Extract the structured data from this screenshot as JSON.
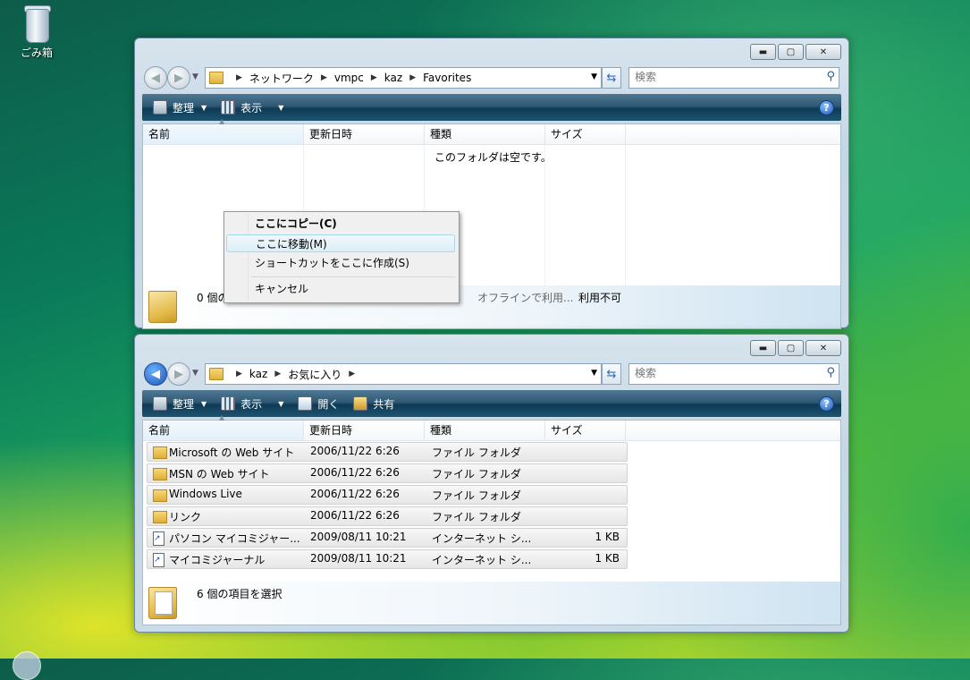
{
  "desktop": {
    "recycle_bin": "ごみ箱"
  },
  "window1": {
    "breadcrumbs": [
      "ネットワーク",
      "vmpc",
      "kaz",
      "Favorites"
    ],
    "search_placeholder": "検索",
    "toolbar": {
      "organize": "整理",
      "views": "表示"
    },
    "columns": [
      "名前",
      "更新日時",
      "種類",
      "サイズ"
    ],
    "empty_message": "このフォルダは空です。",
    "details": {
      "count_text": "0 個の",
      "offline_label": "オフラインで利用...",
      "offline_value": "利用不可"
    }
  },
  "context_menu": {
    "items": [
      "ここにコピー(C)",
      "ここに移動(M)",
      "ショートカットをここに作成(S)",
      "キャンセル"
    ],
    "default_item": "ここにコピー(C)",
    "highlighted_item": "ここに移動(M)"
  },
  "window2": {
    "breadcrumbs": [
      "kaz",
      "お気に入り"
    ],
    "search_placeholder": "検索",
    "toolbar": {
      "organize": "整理",
      "views": "表示",
      "open": "開く",
      "share": "共有"
    },
    "columns": [
      "名前",
      "更新日時",
      "種類",
      "サイズ"
    ],
    "rows": [
      {
        "name": "Microsoft の Web サイト",
        "date": "2006/11/22 6:26",
        "type": "ファイル フォルダ",
        "size": ""
      },
      {
        "name": "MSN の Web サイト",
        "date": "2006/11/22 6:26",
        "type": "ファイル フォルダ",
        "size": ""
      },
      {
        "name": "Windows Live",
        "date": "2006/11/22 6:26",
        "type": "ファイル フォルダ",
        "size": ""
      },
      {
        "name": "リンク",
        "date": "2006/11/22 6:26",
        "type": "ファイル フォルダ",
        "size": ""
      },
      {
        "name": "パソコン マイコミジャー...",
        "date": "2009/08/11 10:21",
        "type": "インターネット シ...",
        "size": "1 KB"
      },
      {
        "name": "マイコミジャーナル",
        "date": "2009/08/11 10:21",
        "type": "インターネット シ...",
        "size": "1 KB"
      }
    ],
    "details": {
      "count_text": "6 個の項目を選択"
    }
  }
}
